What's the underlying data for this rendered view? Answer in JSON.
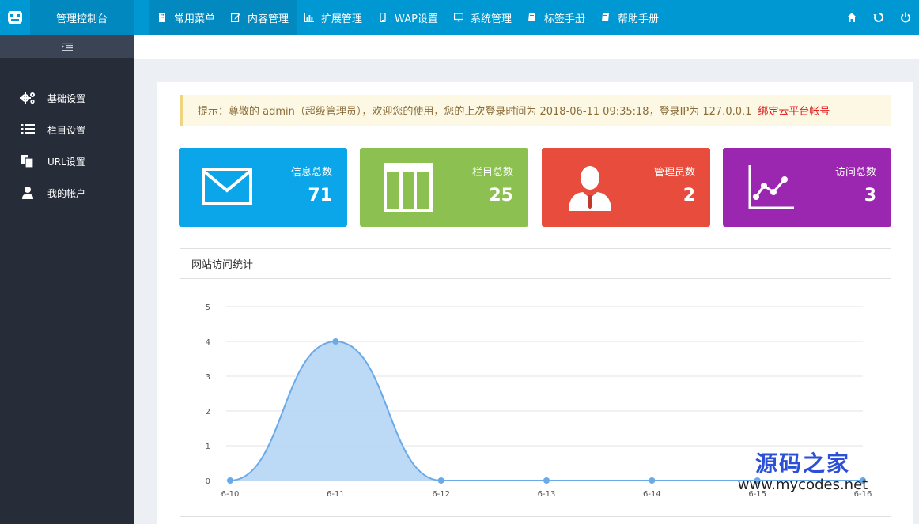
{
  "header": {
    "brand": "管理控制台",
    "menu": [
      {
        "label": "常用菜单",
        "icon": "building-icon"
      },
      {
        "label": "内容管理",
        "icon": "edit-icon"
      },
      {
        "label": "扩展管理",
        "icon": "bar-chart-icon"
      },
      {
        "label": "WAP设置",
        "icon": "mobile-icon"
      },
      {
        "label": "系统管理",
        "icon": "monitor-icon"
      },
      {
        "label": "标签手册",
        "icon": "book-icon"
      },
      {
        "label": "帮助手册",
        "icon": "book-icon"
      }
    ],
    "right_icons": [
      "home-icon",
      "refresh-icon",
      "power-icon"
    ]
  },
  "sidebar": {
    "items": [
      {
        "label": "基础设置",
        "icon": "gears-icon"
      },
      {
        "label": "栏目设置",
        "icon": "list-icon"
      },
      {
        "label": "URL设置",
        "icon": "copy-icon"
      },
      {
        "label": "我的帐户",
        "icon": "user-icon"
      }
    ]
  },
  "notice": {
    "text": "提示：尊敬的 admin（超级管理员），欢迎您的使用，您的上次登录时间为 2018-06-11 09:35:18，登录IP为 127.0.0.1",
    "link": "绑定云平台帐号"
  },
  "stats": [
    {
      "label": "信息总数",
      "value": "71",
      "color": "#0aa6e9",
      "icon": "envelope-icon"
    },
    {
      "label": "栏目总数",
      "value": "25",
      "color": "#8cc152",
      "icon": "table-icon"
    },
    {
      "label": "管理员数",
      "value": "2",
      "color": "#e74c3c",
      "icon": "admin-user-icon"
    },
    {
      "label": "访问总数",
      "value": "3",
      "color": "#9b27b0",
      "icon": "line-chart-icon"
    }
  ],
  "chart_section": {
    "title": "网站访问统计"
  },
  "chart_data": {
    "type": "area",
    "x": [
      "6-10",
      "6-11",
      "6-12",
      "6-13",
      "6-14",
      "6-15",
      "6-16"
    ],
    "values": [
      0,
      4,
      0,
      0,
      0,
      0,
      0
    ],
    "ylim": [
      0,
      5
    ],
    "y_ticks": [
      "0",
      "1",
      "2",
      "3",
      "4",
      "5"
    ],
    "grid": true,
    "line_color": "#6aaae8",
    "fill_color": "#b8d7f4"
  },
  "watermark": {
    "cn": "源码之家",
    "url": "www.mycodes.net"
  }
}
